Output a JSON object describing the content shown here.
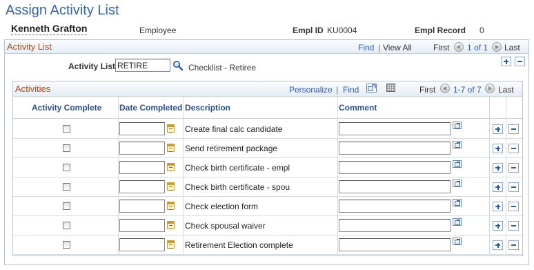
{
  "page": {
    "title": "Assign Activity List"
  },
  "header": {
    "name": "Kenneth Grafton",
    "role": "Employee",
    "empl_id_label": "Empl ID",
    "empl_id": "KU0004",
    "empl_record_label": "Empl Record",
    "empl_record": "0"
  },
  "activity_list": {
    "title": "Activity List",
    "find": "Find",
    "sep": "|",
    "view_all": "View All",
    "first": "First",
    "count": "1 of 1",
    "last": "Last",
    "field_label": "Activity List",
    "field_value": "RETIRE",
    "description": "Checklist - Retiree"
  },
  "activities": {
    "title": "Activities",
    "personalize": "Personalize",
    "sep": "|",
    "find": "Find",
    "first": "First",
    "count": "1-7 of 7",
    "last": "Last",
    "columns": {
      "complete": "Activity Complete",
      "date": "Date Completed",
      "description": "Description",
      "comment": "Comment"
    },
    "rows": [
      {
        "description": "Create final calc candidate",
        "checked": false,
        "date": "",
        "comment": ""
      },
      {
        "description": "Send retirement package",
        "checked": false,
        "date": "",
        "comment": ""
      },
      {
        "description": "Check birth certificate - empl",
        "checked": false,
        "date": "",
        "comment": ""
      },
      {
        "description": "Check birth certificate - spou",
        "checked": false,
        "date": "",
        "comment": ""
      },
      {
        "description": "Check election form",
        "checked": false,
        "date": "",
        "comment": ""
      },
      {
        "description": "Check spousal waiver",
        "checked": false,
        "date": "",
        "comment": ""
      },
      {
        "description": "Retirement Election complete",
        "checked": false,
        "date": "",
        "comment": ""
      }
    ]
  },
  "icons": {
    "lookup": "magnifier-icon",
    "calendar": "calendar-icon",
    "expand": "expand-comment-icon",
    "add": "add-row-icon",
    "delete": "delete-row-icon",
    "view_all_grid": "grid-icon",
    "zoom": "zoom-icon"
  },
  "colors": {
    "title_blue": "#3a64a8",
    "section_orange": "#b04a1e",
    "link_blue": "#2c5aa0",
    "header_col": "#2c4f86"
  }
}
